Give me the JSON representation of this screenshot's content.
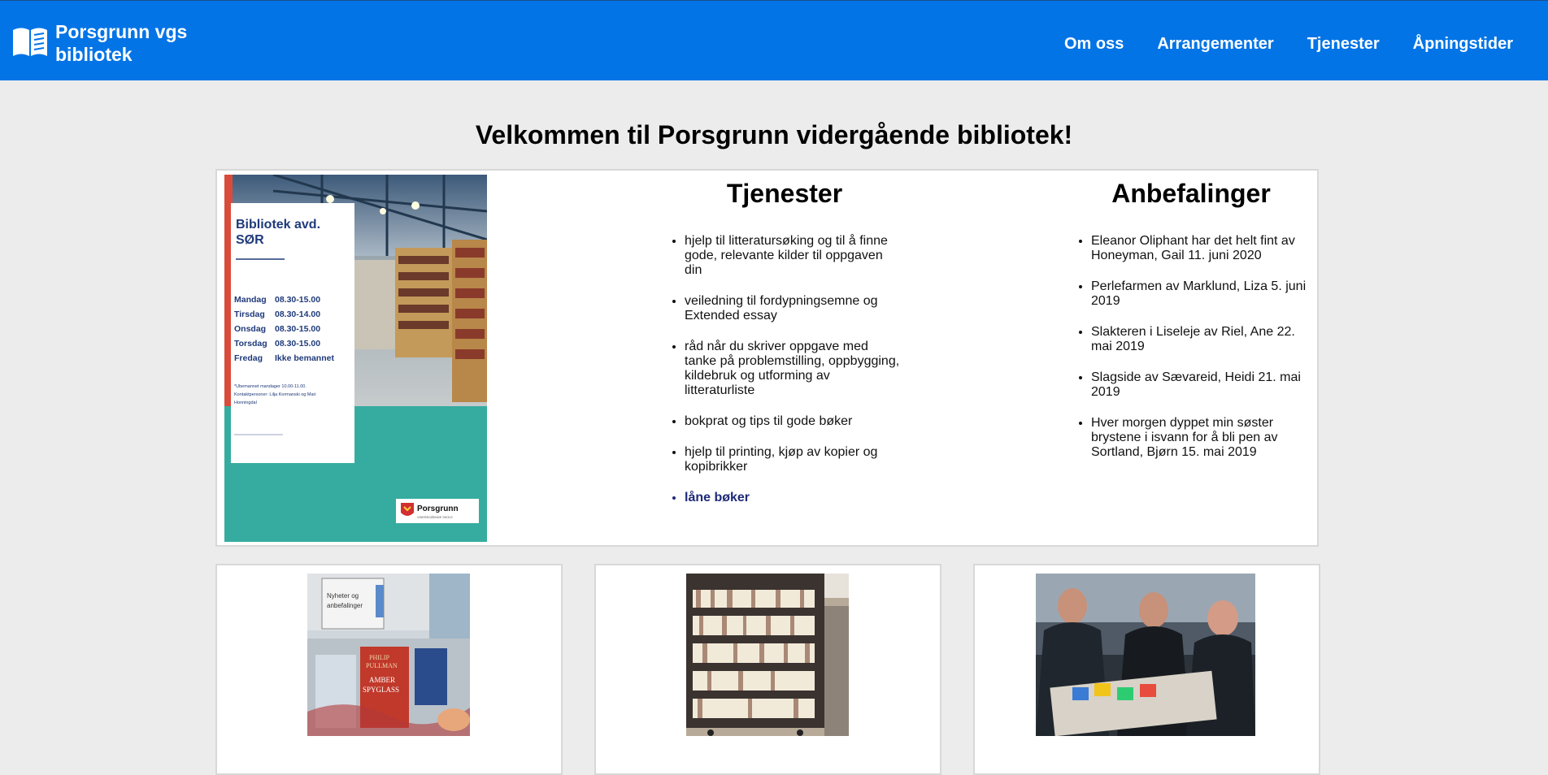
{
  "navbar": {
    "brand_line1": "Porsgrunn vgs",
    "brand_line2": "bibliotek",
    "brand_icon": "open-book-icon",
    "links": [
      {
        "label": "Om oss"
      },
      {
        "label": "Arrangementer"
      },
      {
        "label": "Tjenester"
      },
      {
        "label": "Åpningstider"
      }
    ]
  },
  "page_title": "Velkommen til Porsgrunn vidergående bibliotek!",
  "poster": {
    "heading_line1": "Bibliotek avd.",
    "heading_line2": "SØR",
    "hours": [
      {
        "day": "Mandag",
        "time": "08.30-15.00"
      },
      {
        "day": "Tirsdag",
        "time": "08.30-14.00"
      },
      {
        "day": "Onsdag",
        "time": "08.30-15.00"
      },
      {
        "day": "Torsdag",
        "time": "08.30-15.00"
      },
      {
        "day": "Fredag",
        "time": "Ikke bemannet"
      }
    ],
    "note_line1": "*Ubemannet mandager 10.00-11.00.",
    "note_line2": "Kontaktpersoner: Lilja Kormanski og Mari",
    "note_line3": "Honningdal",
    "logo_name": "Porsgrunn",
    "logo_sub": "VIDEREGÅENDE SKOLE"
  },
  "services": {
    "title": "Tjenester",
    "items": [
      "hjelp til litteratursøking og til å finne gode, relevante kilder til oppgaven din",
      "veiledning til fordypningsemne og Extended essay",
      "råd når du skriver oppgave med tanke på problemstilling, oppbygging, kildebruk og utforming av litteraturliste",
      "bokprat og tips til gode bøker",
      "hjelp til printing, kjøp av kopier og kopibrikker"
    ],
    "link_item": "låne bøker"
  },
  "recommendations": {
    "title": "Anbefalinger",
    "items": [
      "Eleanor Oliphant har det helt fint av Honeyman, Gail 11. juni 2020",
      "Perlefarmen av Marklund, Liza 5. juni 2019",
      "Slakteren i Liseleje av Riel, Ane 22. mai 2019",
      "Slagside av Sævareid, Heidi 21. mai 2019",
      "Hver morgen dyppet min søster brystene i isvann for å bli pen av Sortland, Bjørn 15. mai 2019"
    ]
  },
  "tiles": {
    "tile1": {
      "sign_line1": "Nyheter og",
      "sign_line2": "anbefalinger",
      "book1_line1": "PHILIP",
      "book1_line2": "PULLMAN",
      "book1_line3": "AMBER",
      "book1_line4": "SPYGLASS"
    },
    "tile2": {},
    "tile3": {}
  }
}
